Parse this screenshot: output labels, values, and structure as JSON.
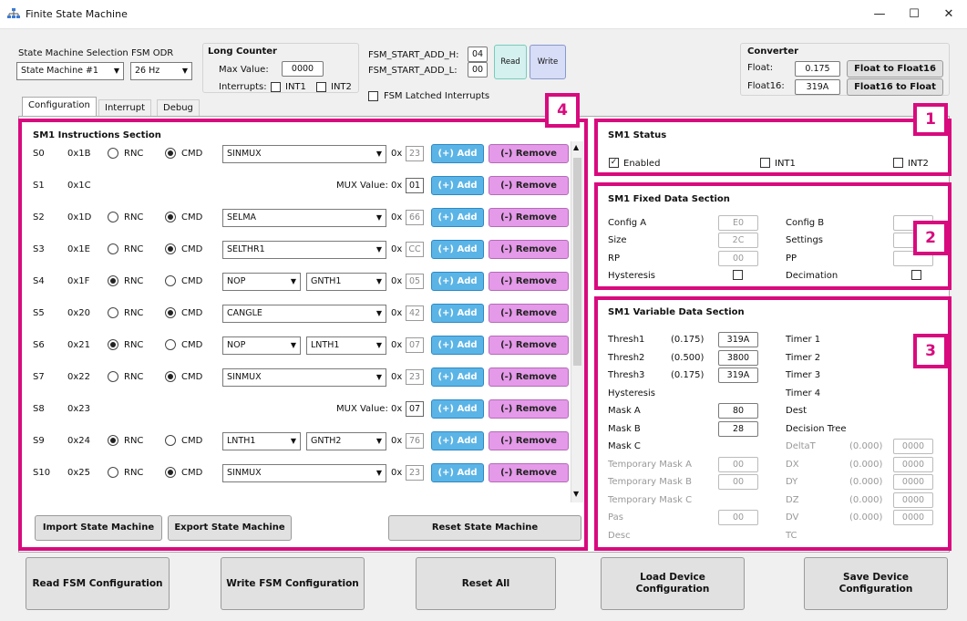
{
  "window": {
    "title": "Finite State Machine",
    "min": "—",
    "max": "☐",
    "close": "✕"
  },
  "top": {
    "sm_sel_label": "State Machine Selection",
    "sm_sel_value": "State Machine #1",
    "odr_label": "FSM ODR",
    "odr_value": "26 Hz",
    "long_counter": {
      "title": "Long Counter",
      "max_label": "Max Value:",
      "max_value": "0000",
      "int_label": "Interrupts:",
      "int1": "INT1",
      "int2": "INT2"
    },
    "start_h_label": "FSM_START_ADD_H:",
    "start_h": "04",
    "start_l_label": "FSM_START_ADD_L:",
    "start_l": "00",
    "read": "Read",
    "write": "Write",
    "latched": "FSM Latched Interrupts",
    "converter": {
      "title": "Converter",
      "float_label": "Float:",
      "float_value": "0.175",
      "f2f16": "Float to Float16",
      "float16_label": "Float16:",
      "float16_value": "319A",
      "f162f": "Float16 to Float"
    }
  },
  "tabs": [
    "Configuration",
    "Interrupt",
    "Debug"
  ],
  "instr": {
    "title": "SM1 Instructions Section",
    "rnc": "RNC",
    "cmd": "CMD",
    "ox": "0x",
    "add": "(+) Add",
    "remove": "(-) Remove",
    "mux_label": "MUX Value:",
    "rows": [
      {
        "s": "S0",
        "a": "0x1B",
        "type": "cmd",
        "rsel": "cmd",
        "sel1": "SINMUX",
        "hex": "23"
      },
      {
        "s": "S1",
        "a": "0x1C",
        "type": "mux",
        "mux": "01"
      },
      {
        "s": "S2",
        "a": "0x1D",
        "type": "cmd",
        "rsel": "cmd",
        "sel1": "SELMA",
        "hex": "66"
      },
      {
        "s": "S3",
        "a": "0x1E",
        "type": "cmd",
        "rsel": "cmd",
        "sel1": "SELTHR1",
        "hex": "CC"
      },
      {
        "s": "S4",
        "a": "0x1F",
        "type": "rnc",
        "rsel": "rnc",
        "sel1": "NOP",
        "sel2": "GNTH1",
        "hex": "05"
      },
      {
        "s": "S5",
        "a": "0x20",
        "type": "cmd",
        "rsel": "cmd",
        "sel1": "CANGLE",
        "hex": "42"
      },
      {
        "s": "S6",
        "a": "0x21",
        "type": "rnc",
        "rsel": "rnc",
        "sel1": "NOP",
        "sel2": "LNTH1",
        "hex": "07"
      },
      {
        "s": "S7",
        "a": "0x22",
        "type": "cmd",
        "rsel": "cmd",
        "sel1": "SINMUX",
        "hex": "23"
      },
      {
        "s": "S8",
        "a": "0x23",
        "type": "mux",
        "mux": "07"
      },
      {
        "s": "S9",
        "a": "0x24",
        "type": "rnc",
        "rsel": "rnc",
        "sel1": "LNTH1",
        "sel2": "GNTH2",
        "hex": "76"
      },
      {
        "s": "S10",
        "a": "0x25",
        "type": "cmd",
        "rsel": "cmd",
        "sel1": "SINMUX",
        "hex": "23"
      }
    ],
    "import": "Import State Machine",
    "export": "Export State Machine",
    "reset": "Reset State Machine"
  },
  "status": {
    "title": "SM1 Status",
    "enabled": "Enabled",
    "int1": "INT1",
    "int2": "INT2"
  },
  "fixed": {
    "title": "SM1 Fixed Data Section",
    "config_a": "Config A",
    "config_a_v": "E0",
    "size": "Size",
    "size_v": "2C",
    "rp": "RP",
    "rp_v": "00",
    "hyst": "Hysteresis",
    "config_b": "Config B",
    "settings": "Settings",
    "pp": "PP",
    "decimation": "Decimation"
  },
  "variable": {
    "title": "SM1 Variable Data Section",
    "left": [
      {
        "l": "Thresh1",
        "p": "(0.175)",
        "v": "319A"
      },
      {
        "l": "Thresh2",
        "p": "(0.500)",
        "v": "3800"
      },
      {
        "l": "Thresh3",
        "p": "(0.175)",
        "v": "319A"
      },
      {
        "l": "Hysteresis"
      },
      {
        "l": "Mask A",
        "v": "80"
      },
      {
        "l": "Mask B",
        "v": "28"
      },
      {
        "l": "Mask C"
      },
      {
        "l": "Temporary Mask A",
        "v": "00"
      },
      {
        "l": "Temporary Mask B",
        "v": "00"
      },
      {
        "l": "Temporary Mask C"
      },
      {
        "l": "Pas",
        "v": "00"
      },
      {
        "l": "Desc"
      }
    ],
    "right": [
      {
        "l": "Timer 1"
      },
      {
        "l": "Timer 2"
      },
      {
        "l": "Timer 3"
      },
      {
        "l": "Timer 4"
      },
      {
        "l": "Dest"
      },
      {
        "l": "Decision Tree"
      },
      {
        "l": "DeltaT",
        "p": "(0.000)",
        "v": "0000"
      },
      {
        "l": "DX",
        "p": "(0.000)",
        "v": "0000"
      },
      {
        "l": "DY",
        "p": "(0.000)",
        "v": "0000"
      },
      {
        "l": "DZ",
        "p": "(0.000)",
        "v": "0000"
      },
      {
        "l": "DV",
        "p": "(0.000)",
        "v": "0000"
      },
      {
        "l": "TC"
      }
    ]
  },
  "bottom": [
    "Read FSM Configuration",
    "Write FSM Configuration",
    "Reset All",
    "Load Device Configuration",
    "Save Device Configuration"
  ],
  "badges": [
    "1",
    "2",
    "3",
    "4"
  ]
}
